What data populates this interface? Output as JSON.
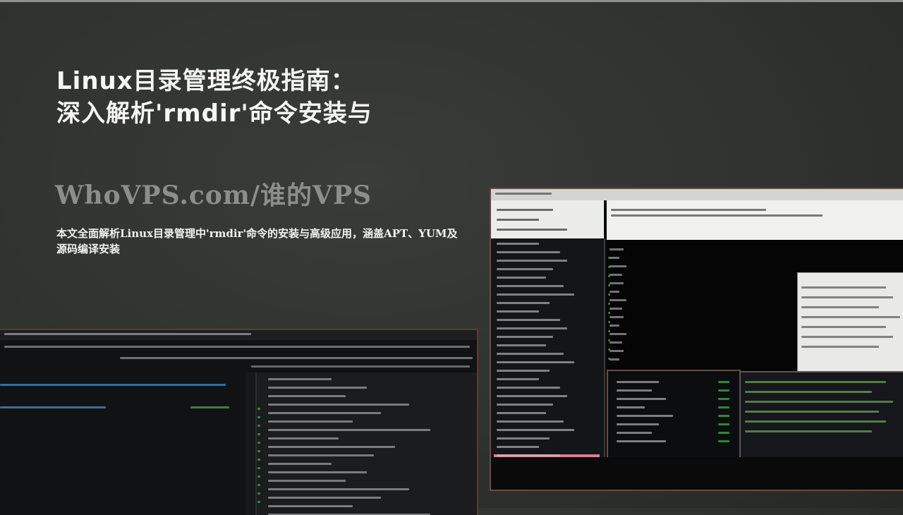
{
  "article": {
    "title_line1": "Linux目录管理终极指南：",
    "title_line2": "深入解析'rmdir'命令安装与",
    "site": "WhoVPS.com/谁的VPS",
    "description": "本文全面解析Linux目录管理中'rmdir'命令的安装与高级应用，涵盖APT、YUM及源码编译安装"
  },
  "colors": {
    "background": "#323432",
    "title": "#f6f6f2",
    "site": "#8c8e8c",
    "description": "#f2f2ee"
  }
}
